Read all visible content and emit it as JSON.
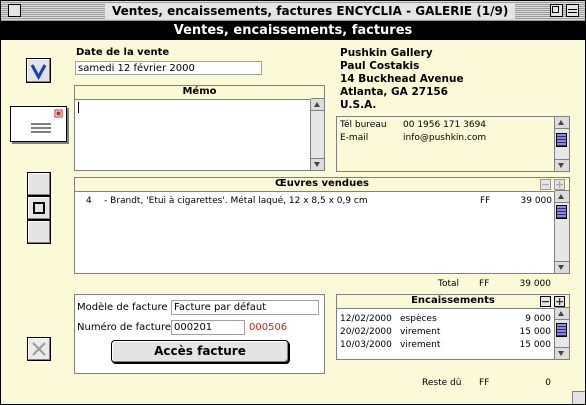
{
  "window": {
    "title": "Ventes, encaissements, factures ENCYCLIA - GALERIE (1/9)",
    "header": "Ventes, encaissements, factures"
  },
  "sale": {
    "date_label": "Date de la vente",
    "date_value": "samedi 12 février 2000",
    "memo_label": "Mémo",
    "memo_value": ""
  },
  "customer": {
    "name": "Pushkin Gallery",
    "contact": "Paul Costakis",
    "street": "14 Buckhead Avenue",
    "city": "Atlanta, GA 27156",
    "country": "U.S.A.",
    "contacts": [
      {
        "label": "Tél bureau",
        "value": "00 1956 171 3694"
      },
      {
        "label": "E-mail",
        "value": "info@pushkin.com"
      }
    ]
  },
  "works": {
    "title": "Œuvres vendues",
    "rows": [
      {
        "num": "4",
        "desc": "- Brandt, 'Etui à cigarettes'. Métal laqué, 12 x 8,5 x 0,9 cm",
        "currency": "FF",
        "amount": "39 000"
      }
    ],
    "total_label": "Total",
    "total_currency": "FF",
    "total_amount": "39 000"
  },
  "invoice": {
    "model_label": "Modèle de facture",
    "model_value": "Facture par défaut",
    "number_label": "Numéro de facture",
    "number_value": "000201",
    "next_number": "000506",
    "access_button": "Accès facture"
  },
  "payments": {
    "title": "Encaissements",
    "rows": [
      {
        "date": "12/02/2000",
        "type": "espèces",
        "amount": "9 000"
      },
      {
        "date": "20/02/2000",
        "type": "virement",
        "amount": "15 000"
      },
      {
        "date": "10/03/2000",
        "type": "virement",
        "amount": "15 000"
      }
    ],
    "remaining_label": "Reste dû",
    "remaining_currency": "FF",
    "remaining_amount": "0"
  },
  "colors": {
    "background": "#fcf9d6",
    "accent_blue": "#1a3cc8",
    "next_number_red": "#c8281e"
  },
  "icons": {
    "validate": "checkmark-v-icon",
    "envelope": "envelope-icon",
    "delete": "x-delete-icon"
  }
}
